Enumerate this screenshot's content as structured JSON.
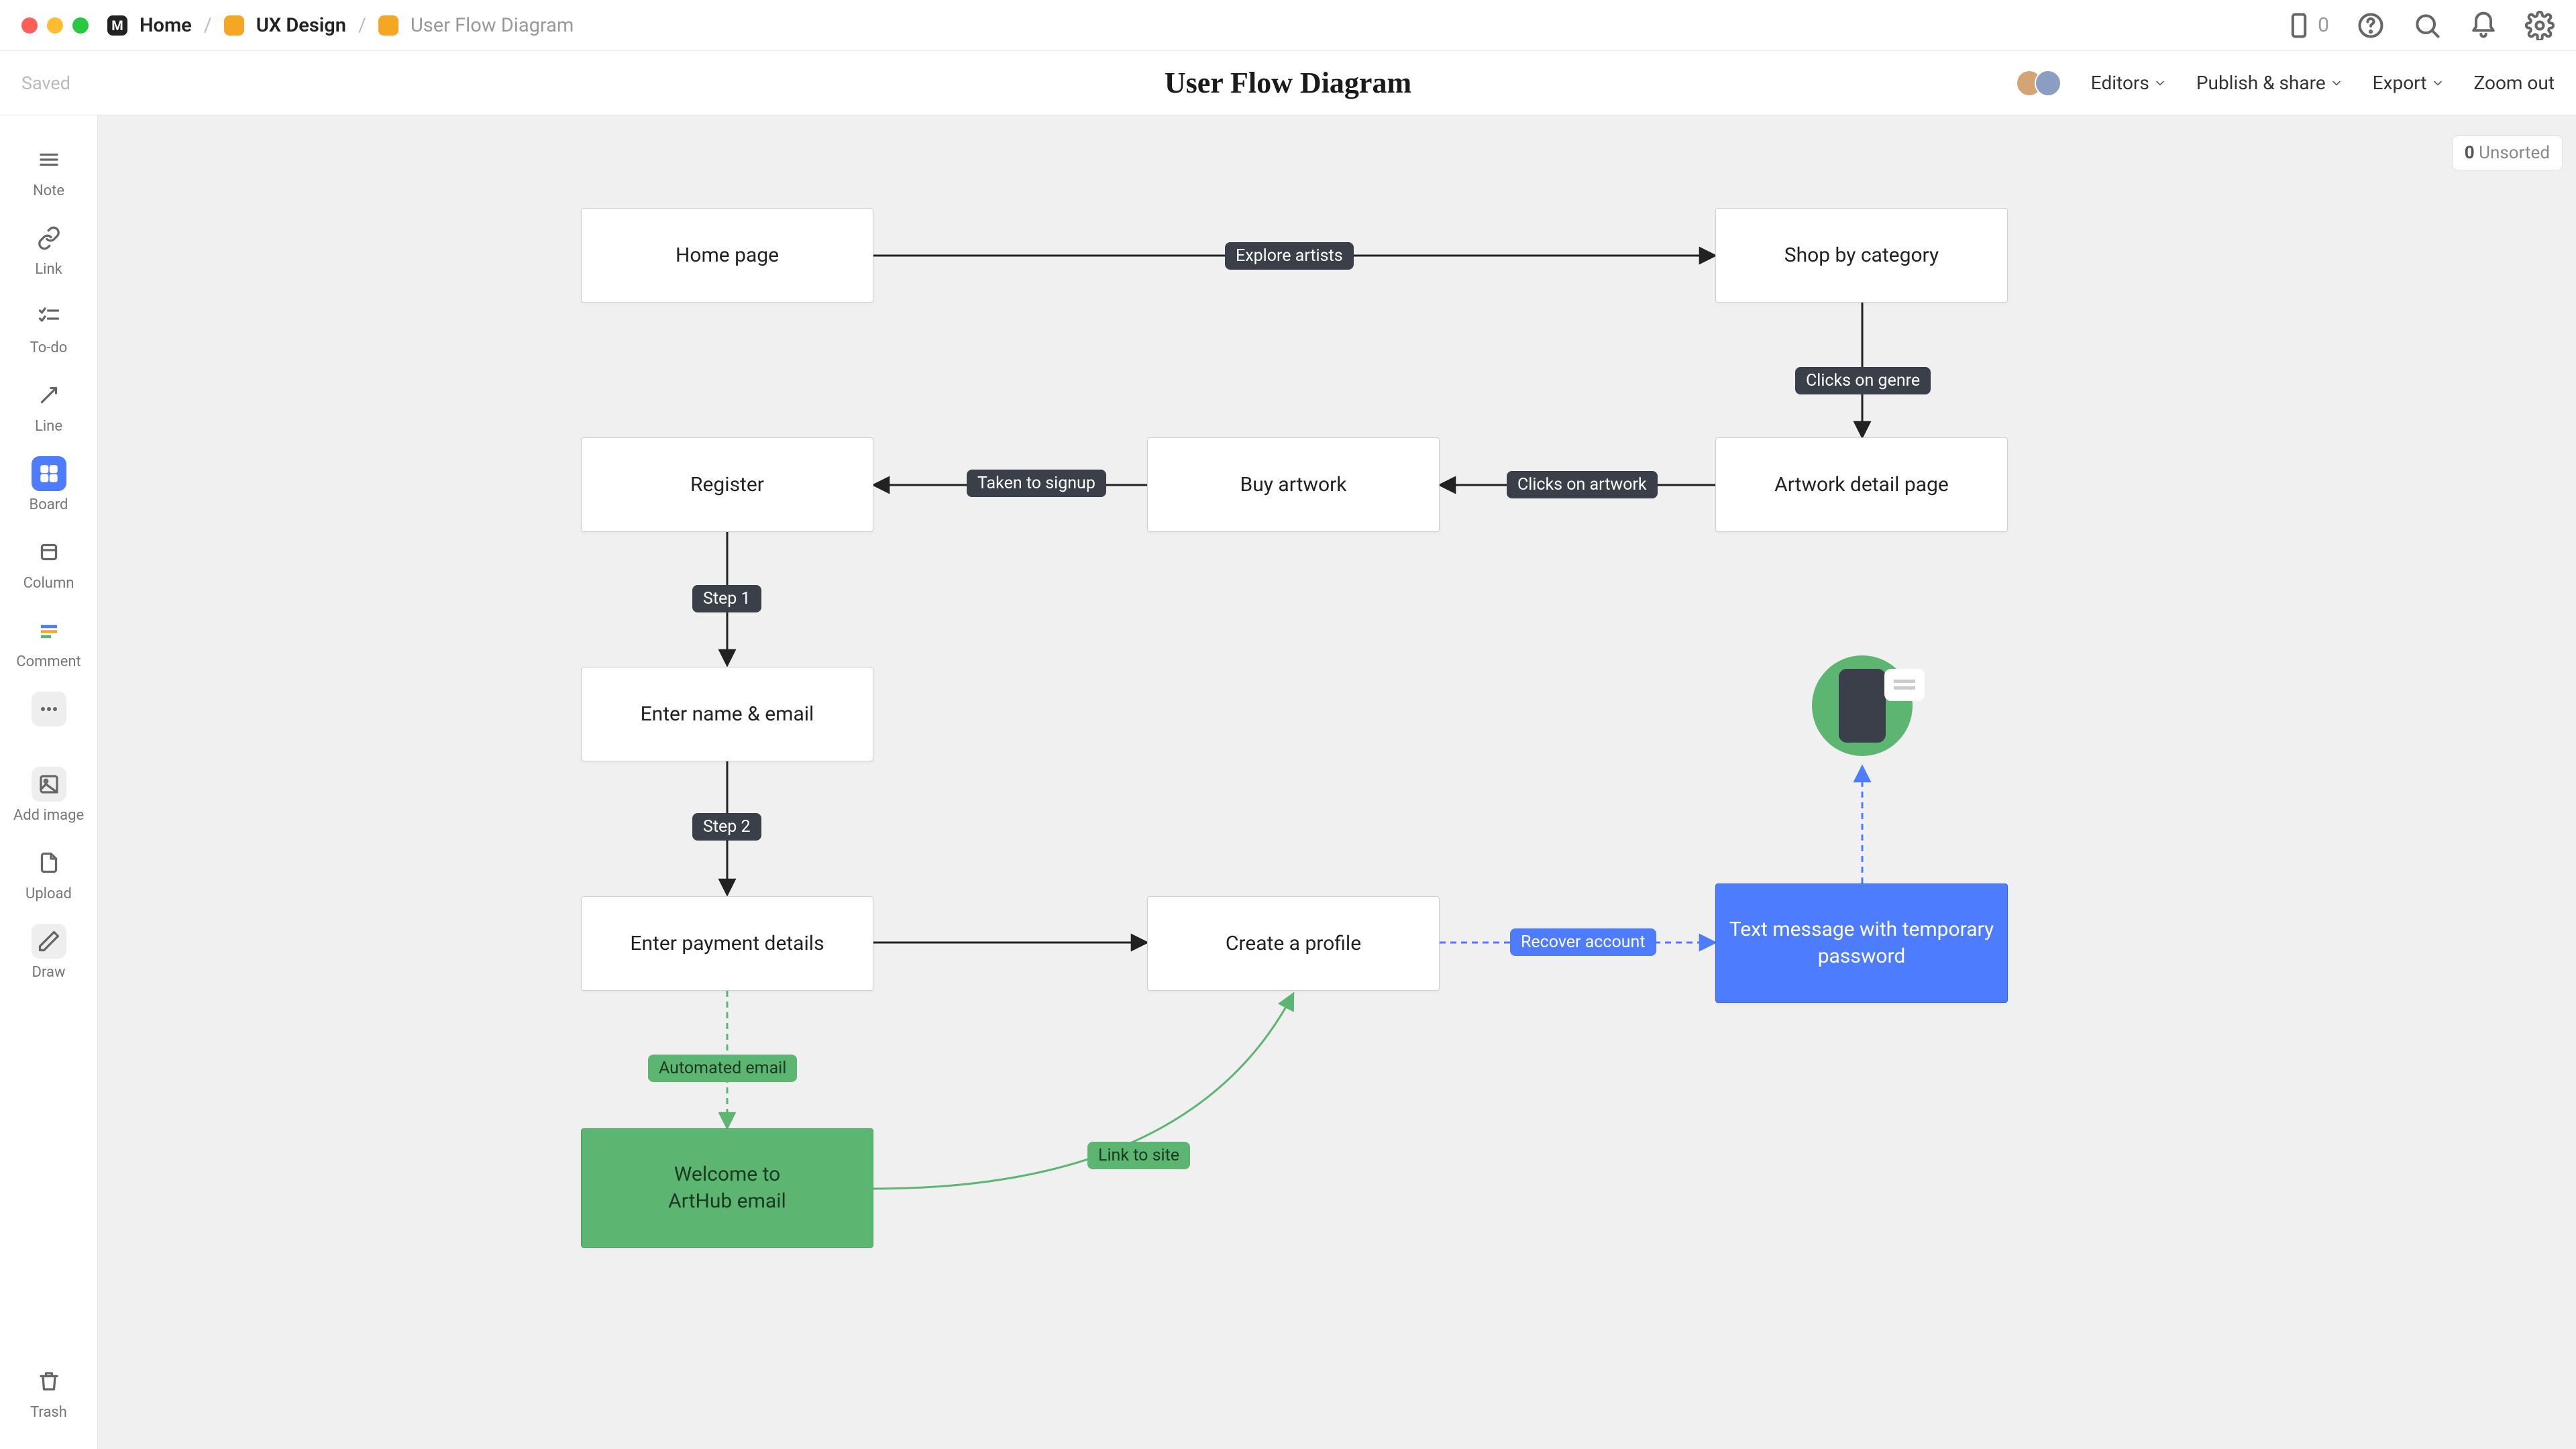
{
  "breadcrumbs": {
    "home": "Home",
    "project": "UX Design",
    "page": "User Flow Diagram"
  },
  "topbar": {
    "badge_count": "0"
  },
  "subhead": {
    "saved": "Saved",
    "title": "User Flow Diagram",
    "editors": "Editors",
    "publish": "Publish & share",
    "export": "Export",
    "zoom_out": "Zoom out"
  },
  "sidebar": {
    "note": "Note",
    "link": "Link",
    "todo": "To-do",
    "line": "Line",
    "board": "Board",
    "column": "Column",
    "comment": "Comment",
    "more": "",
    "add_image": "Add image",
    "upload": "Upload",
    "draw": "Draw",
    "trash": "Trash"
  },
  "unsorted": {
    "count": "0",
    "label": "Unsorted"
  },
  "nodes": {
    "home_page": "Home page",
    "shop_category": "Shop by category",
    "artwork_detail": "Artwork detail page",
    "buy_artwork": "Buy artwork",
    "register": "Register",
    "enter_name": "Enter name & email",
    "enter_payment": "Enter payment details",
    "create_profile": "Create a profile",
    "text_msg": "Text message with temporary password",
    "welcome_l1": "Welcome to",
    "welcome_l2": "ArtHub email"
  },
  "edges": {
    "explore": "Explore artists",
    "clicks_genre": "Clicks on genre",
    "clicks_artwork": "Clicks on artwork",
    "taken_signup": "Taken to signup",
    "step1": "Step 1",
    "step2": "Step 2",
    "automated": "Automated email",
    "link_site": "Link to site",
    "recover": "Recover account"
  }
}
